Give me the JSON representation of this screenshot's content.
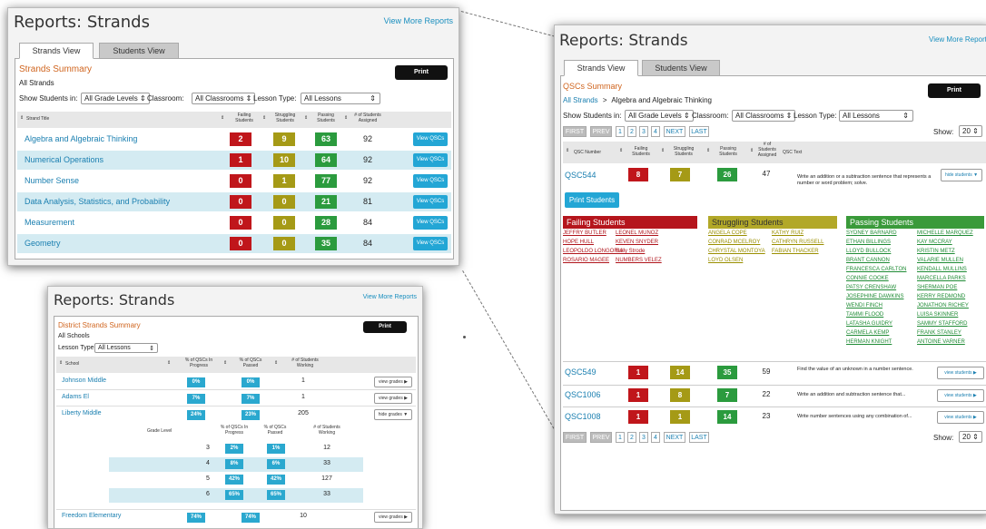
{
  "common": {
    "title": "Reports: Strands",
    "view_more": "View More Reports",
    "print": "Print",
    "tab_strands": "Strands View",
    "tab_students": "Students View",
    "view_qscs": "View QSCs"
  },
  "p1": {
    "summary": "Strands Summary",
    "sub": "All Strands",
    "show_students_in": "Show Students in:",
    "grade": "All Grade Levels",
    "classroom_lbl": "Classroom:",
    "classroom": "All Classrooms",
    "lesson_lbl": "Lesson Type:",
    "lesson": "All Lessons",
    "h_title": "Strand Title",
    "h_failing": "Failing Students",
    "h_struggling": "Struggling Students",
    "h_passing": "Passing Students",
    "h_assigned": "# of Students Assigned",
    "rows": [
      {
        "title": "Algebra and Algebraic Thinking",
        "f": "2",
        "s": "9",
        "p": "63",
        "a": "92"
      },
      {
        "title": "Numerical Operations",
        "f": "1",
        "s": "10",
        "p": "64",
        "a": "92"
      },
      {
        "title": "Number Sense",
        "f": "0",
        "s": "1",
        "p": "77",
        "a": "92"
      },
      {
        "title": "Data Analysis, Statistics, and Probability",
        "f": "0",
        "s": "0",
        "p": "21",
        "a": "81"
      },
      {
        "title": "Measurement",
        "f": "0",
        "s": "0",
        "p": "28",
        "a": "84"
      },
      {
        "title": "Geometry",
        "f": "0",
        "s": "0",
        "p": "35",
        "a": "84"
      }
    ]
  },
  "p2": {
    "summary": "District Strands Summary",
    "sub": "All Schools",
    "lesson_lbl": "Lesson Type:",
    "lesson": "All Lessons",
    "h_school": "School",
    "h_inprog": "% of QSCs In Progress",
    "h_passed": "% of QSCs Passed",
    "h_working": "# of Students Working",
    "view_grades": "view grades",
    "hide_grades": "hide grades",
    "schools": [
      {
        "name": "Johnson Middle",
        "ip": "0%",
        "ps": "0%",
        "w": "1"
      },
      {
        "name": "Adams El",
        "ip": "7%",
        "ps": "7%",
        "w": "1"
      },
      {
        "name": "Liberty Middle",
        "ip": "24%",
        "ps": "23%",
        "w": "205"
      }
    ],
    "sub_h_grade": "Grade Level",
    "sub_h_inprog": "% of QSCs In Progress",
    "sub_h_passed": "% of QSCs Passed",
    "sub_h_working": "# of Students Working",
    "grades": [
      {
        "g": "3",
        "ip": "2%",
        "ps": "1%",
        "w": "12"
      },
      {
        "g": "4",
        "ip": "8%",
        "ps": "6%",
        "w": "33"
      },
      {
        "g": "5",
        "ip": "42%",
        "ps": "42%",
        "w": "127"
      },
      {
        "g": "6",
        "ip": "65%",
        "ps": "65%",
        "w": "33"
      }
    ],
    "last": {
      "name": "Freedom Elementary",
      "ip": "74%",
      "ps": "74%",
      "w": "10"
    }
  },
  "p3": {
    "summary": "QSCs Summary",
    "crumb1": "All Strands",
    "crumb_sep": ">",
    "crumb2": "Algebra and Algebraic Thinking",
    "show_students_in": "Show Students in:",
    "grade": "All Grade Levels",
    "classroom_lbl": "Classroom:",
    "classroom": "All Classrooms",
    "lesson_lbl": "Lesson Type:",
    "lesson": "All Lessons",
    "pag": {
      "first": "FIRST",
      "prev": "PREV",
      "p1": "1",
      "p2": "2",
      "p3": "3",
      "p4": "4",
      "next": "NEXT",
      "last": "LAST"
    },
    "show_lbl": "Show:",
    "show_val": "20",
    "h_qsc": "QSC Number",
    "h_failing": "Failing Students",
    "h_struggling": "Struggling Students",
    "h_passing": "Passing Students",
    "h_assigned": "# of Students Assigned",
    "h_text": "QSC Text",
    "row1": {
      "id": "QSC544",
      "f": "8",
      "s": "7",
      "p": "26",
      "a": "47",
      "text": "Write an addition or a subtraction sentence that represents a number or word problem; solve."
    },
    "hide_students": "hide students",
    "print_students": "Print Students",
    "failing_h": "Failing Students",
    "struggling_h": "Struggling Students",
    "passing_h": "Passing Students",
    "failing": [
      "JEFFRY BUTLER",
      "LEONEL MUNOZ",
      "HOPE HULL",
      "KEVEN SNYDER",
      "LEOPOLDO LONGORIA",
      "Sally Strode",
      "ROSARIO MAGEE",
      "NUMBERS VELEZ"
    ],
    "struggling": [
      "ANGELA COPE",
      "KATHY RUIZ",
      "CONRAD MCELROY",
      "CATHRYN RUSSELL",
      "CHRYSTAL MONTOYA",
      "FABIAN THACKER",
      "LOYD OLSEN"
    ],
    "passing": [
      "SYDNEY BARNARD",
      "MICHELLE MARQUEZ",
      "ETHAN BILLINGS",
      "KAY MCCRAY",
      "LLOYD BULLOCK",
      "KRISTIN METZ",
      "BRANT CANNON",
      "VALARIE MULLEN",
      "FRANCESCA CARLTON",
      "KENDALL MULLINS",
      "CONNIE COOKE",
      "MARCELLA PARKS",
      "PATSY CRENSHAW",
      "SHERMAN POE",
      "JOSEPHINE DAWKINS",
      "KERRY REDMOND",
      "WENDI FINCH",
      "JONATHON RICHEY",
      "TAMMI FLOOD",
      "LUISA SKINNER",
      "LATASHA GUIDRY",
      "SAMMY STAFFORD",
      "CARMELA KEMP",
      "FRANK STANLEY",
      "HERMAN KNIGHT",
      "ANTOINE VARNER"
    ],
    "view_students": "view students",
    "rows": [
      {
        "id": "QSC549",
        "f": "1",
        "s": "14",
        "p": "35",
        "a": "59",
        "text": "Find the value of an unknown in a number sentence."
      },
      {
        "id": "QSC1006",
        "f": "1",
        "s": "8",
        "p": "7",
        "a": "22",
        "text": "Write an addition and subtraction sentence that..."
      },
      {
        "id": "QSC1008",
        "f": "1",
        "s": "1",
        "p": "14",
        "a": "23",
        "text": "Write number sentences using any combination of..."
      }
    ]
  }
}
